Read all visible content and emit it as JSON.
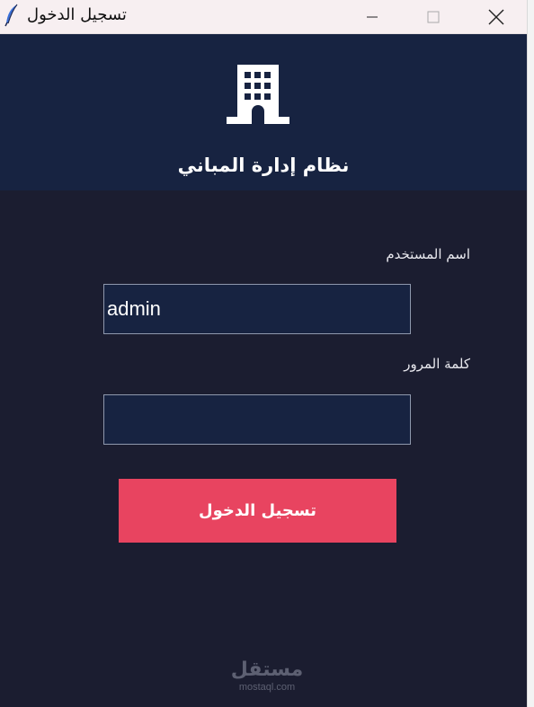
{
  "window": {
    "title": "تسجيل الدخول",
    "icons": {
      "app": "feather-icon",
      "minimize": "minimize-icon",
      "maximize": "maximize-icon",
      "close": "close-icon"
    }
  },
  "header": {
    "icon": "building-icon",
    "title": "نظام إدارة المباني"
  },
  "form": {
    "username": {
      "label": "اسم المستخدم",
      "value": "admin"
    },
    "password": {
      "label": "كلمة المرور",
      "value": ""
    },
    "submit_label": "تسجيل الدخول"
  },
  "watermark": {
    "arabic": "مستقل",
    "latin": "mostaql.com"
  },
  "colors": {
    "titlebar": "#f7eff1",
    "header_bg": "#172341",
    "body_bg": "#1b1d30",
    "input_bg": "#172341",
    "accent": "#e84460"
  }
}
